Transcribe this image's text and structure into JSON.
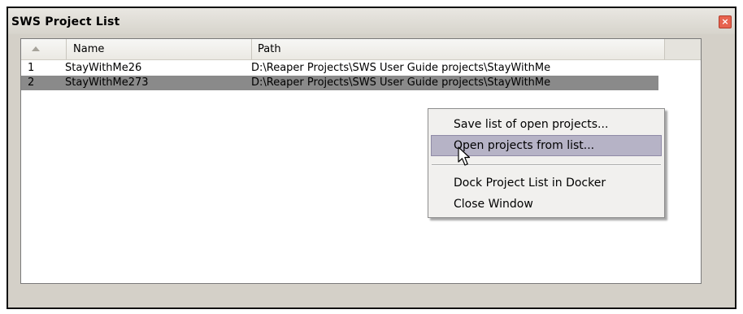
{
  "window": {
    "title": "SWS Project List",
    "close_glyph": "×"
  },
  "list": {
    "columns": {
      "sort": "",
      "name": "Name",
      "path": "Path"
    },
    "rows": [
      {
        "index": "1",
        "name": "StayWithMe26",
        "path": "D:\\Reaper Projects\\SWS User Guide projects\\StayWithMe"
      },
      {
        "index": "2",
        "name": "StayWithMe273",
        "path": "D:\\Reaper Projects\\SWS User Guide projects\\StayWithMe"
      }
    ],
    "selected_row": "2"
  },
  "context_menu": {
    "items": [
      "Save list of open projects...",
      "Open projects from list...",
      "Dock Project List in Docker",
      "Close Window"
    ],
    "highlighted_item": "Open projects from list..."
  },
  "icons": {
    "sort": "sort-ascending-icon",
    "close": "close-icon",
    "cursor": "mouse-pointer-icon"
  }
}
